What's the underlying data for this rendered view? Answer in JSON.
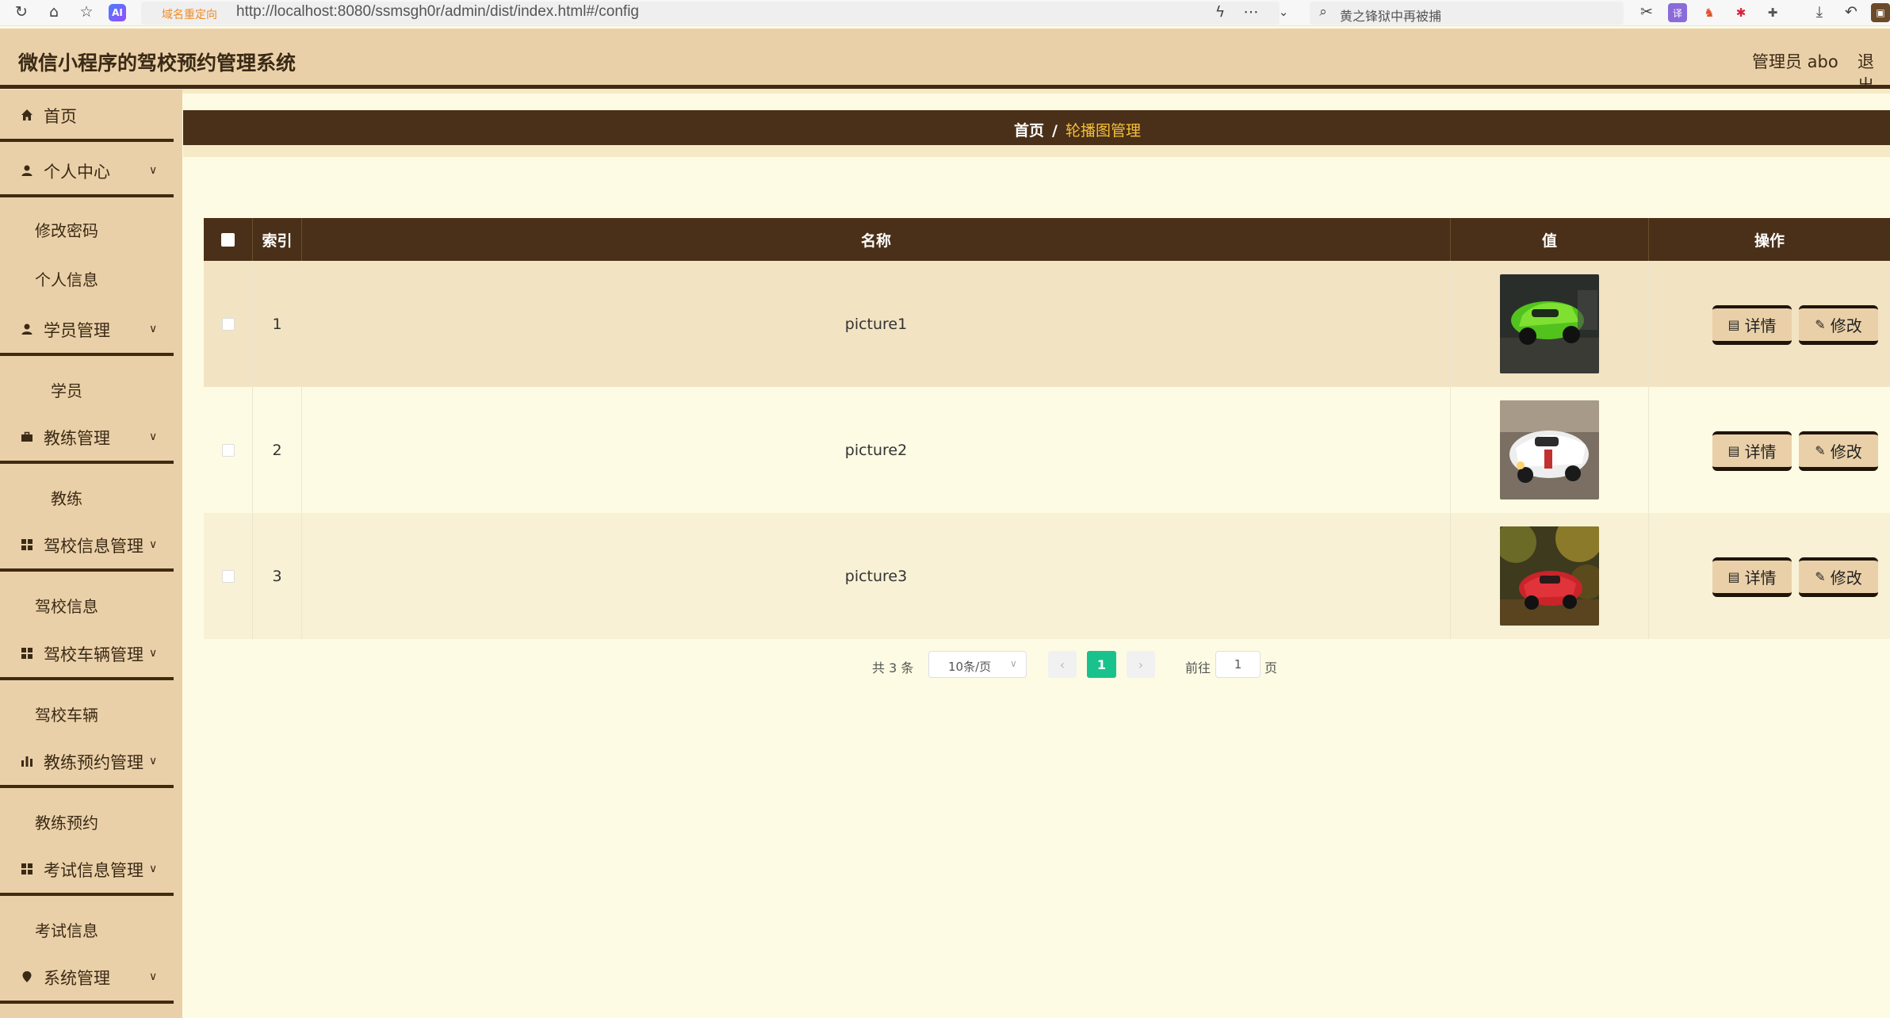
{
  "browser": {
    "redirect_tag": "域名重定向",
    "url": "http://localhost:8080/ssmsgh0r/admin/dist/index.html#/config",
    "search_text": "黄之锋狱中再被捕",
    "ai_badge": "AI"
  },
  "header": {
    "title": "微信小程序的驾校预约管理系统",
    "admin": "管理员 abo",
    "logout": "退出"
  },
  "sidebar": {
    "items": [
      {
        "label": "首页",
        "icon": "home-icon",
        "has_caret": false
      },
      {
        "label": "个人中心",
        "icon": "user-icon",
        "has_caret": true,
        "children": [
          "修改密码",
          "个人信息"
        ]
      },
      {
        "label": "学员管理",
        "icon": "user-icon",
        "has_caret": true,
        "children": [
          "学员"
        ]
      },
      {
        "label": "教练管理",
        "icon": "briefcase-icon",
        "has_caret": true,
        "children": [
          "教练"
        ]
      },
      {
        "label": "驾校信息管理",
        "icon": "grid-icon",
        "has_caret": true,
        "children": [
          "驾校信息"
        ]
      },
      {
        "label": "驾校车辆管理",
        "icon": "grid-icon",
        "has_caret": true,
        "children": [
          "驾校车辆"
        ]
      },
      {
        "label": "教练预约管理",
        "icon": "bar-chart-icon",
        "has_caret": true,
        "children": [
          "教练预约"
        ]
      },
      {
        "label": "考试信息管理",
        "icon": "grid-icon",
        "has_caret": true,
        "children": [
          "考试信息"
        ]
      },
      {
        "label": "系统管理",
        "icon": "location-icon",
        "has_caret": true
      }
    ]
  },
  "breadcrumb": {
    "home": "首页",
    "separator": "/",
    "current": "轮播图管理"
  },
  "table": {
    "headers": {
      "index": "索引",
      "name": "名称",
      "value": "值",
      "actions": "操作"
    },
    "rows": [
      {
        "index": "1",
        "name": "picture1",
        "image": "green-race-car-image"
      },
      {
        "index": "2",
        "name": "picture2",
        "image": "white-race-car-image"
      },
      {
        "index": "3",
        "name": "picture3",
        "image": "red-car-forest-image"
      }
    ],
    "detail_label": "详情",
    "edit_label": "修改"
  },
  "pagination": {
    "total": "共 3 条",
    "page_size": "10条/页",
    "current_page": "1",
    "goto_label": "前往",
    "goto_value": "1",
    "page_unit": "页"
  },
  "colors": {
    "header_bg": "#ead0a8",
    "dark_brown": "#4a3018",
    "content_bg": "#fdfbe3",
    "active_page": "#19c28c",
    "breadcrumb_current": "#f5c038"
  }
}
